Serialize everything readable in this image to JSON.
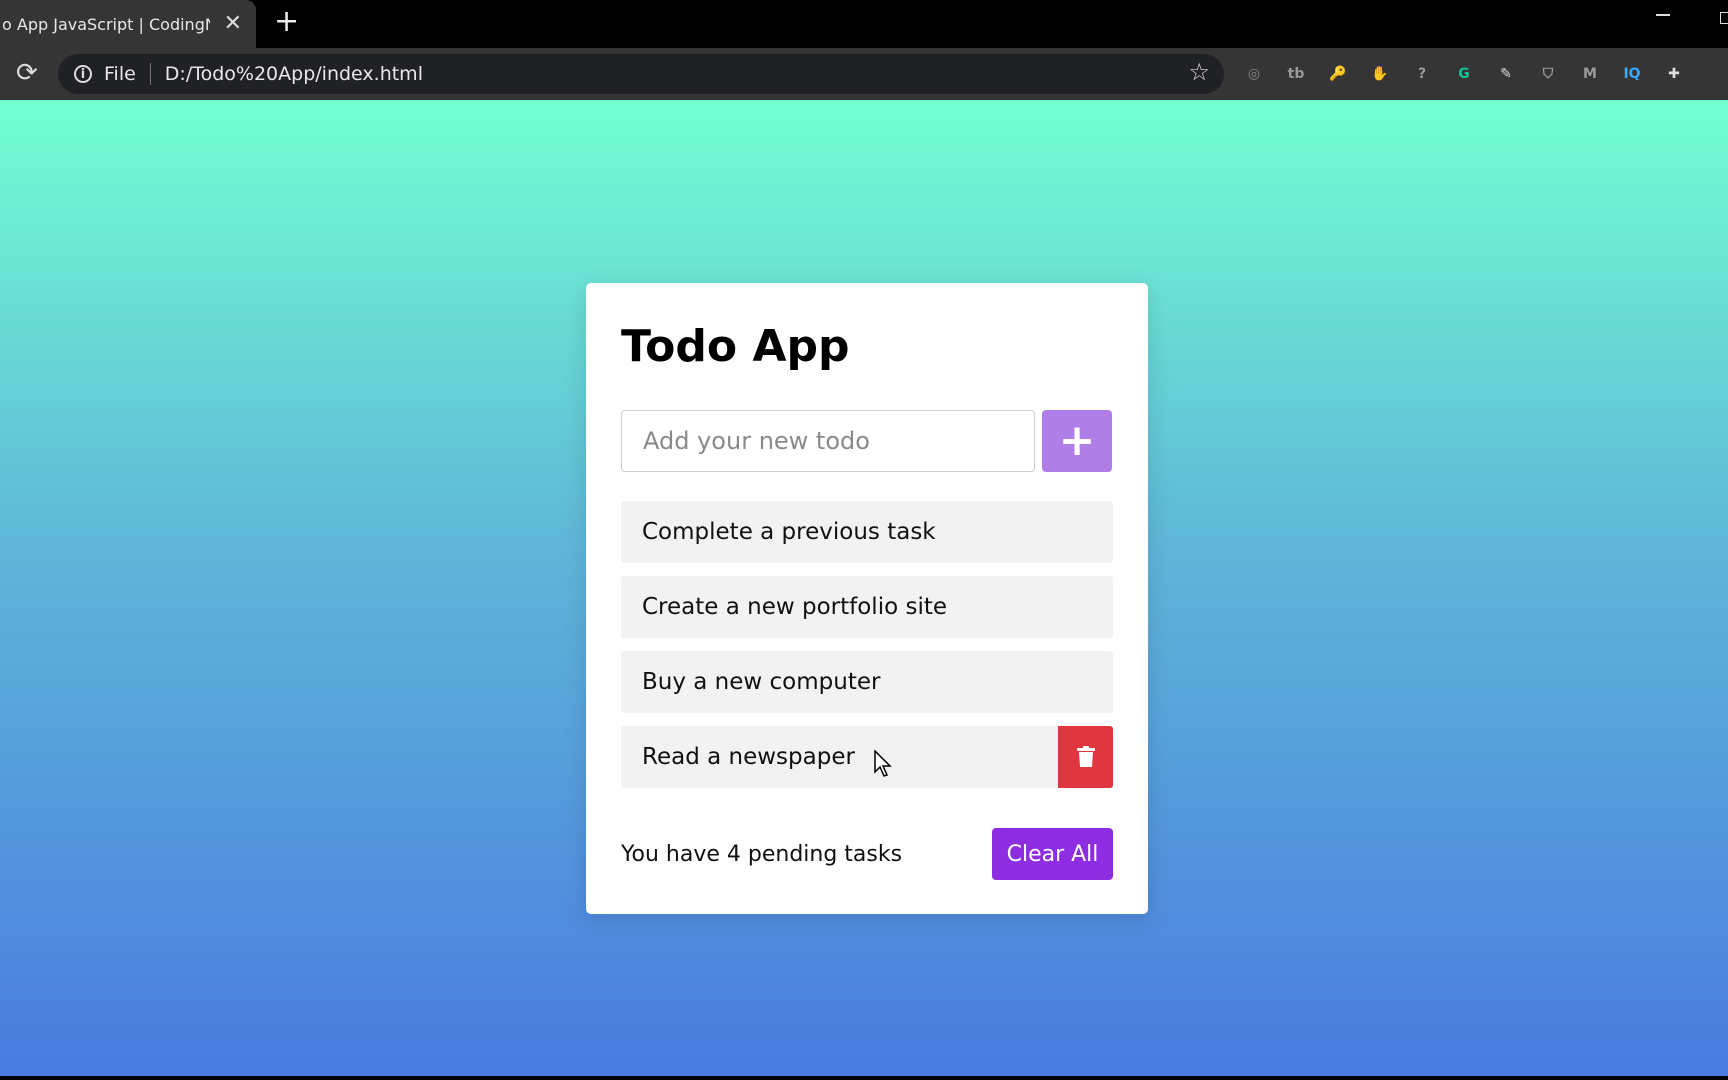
{
  "browser": {
    "tab_title": "o App JavaScript | CodingNep",
    "tab_close": "✕",
    "new_tab": "+",
    "url_scheme_label": "File",
    "url": "D:/Todo%20App/index.html",
    "extensions": [
      {
        "icon": "eye-slash-icon",
        "glyph": "◎",
        "color": "#888888"
      },
      {
        "icon": "tab-icon",
        "glyph": "tb",
        "color": "#9a9a9a"
      },
      {
        "icon": "key-icon",
        "glyph": "🔑",
        "color": "#ff8a00"
      },
      {
        "icon": "hand-stop-icon",
        "glyph": "✋",
        "color": "#e52222"
      },
      {
        "icon": "shield-question-icon",
        "glyph": "?",
        "color": "#9a9a9a"
      },
      {
        "icon": "grammarly-icon",
        "glyph": "G",
        "color": "#15c39a"
      },
      {
        "icon": "pen-icon",
        "glyph": "✎",
        "color": "#dddddd"
      },
      {
        "icon": "shield-icon",
        "glyph": "⛉",
        "color": "#9a9a9a"
      },
      {
        "icon": "m-icon",
        "glyph": "M",
        "color": "#9a9a9a"
      },
      {
        "icon": "iq-icon",
        "glyph": "IQ",
        "color": "#3aa7ff"
      },
      {
        "icon": "puzzle-icon",
        "glyph": "✚",
        "color": "#dddddd"
      }
    ]
  },
  "app": {
    "title": "Todo App",
    "input_placeholder": "Add your new todo",
    "add_label": "+",
    "todos": [
      "Complete a previous task",
      "Create a new portfolio site",
      "Buy a new computer",
      "Read a newspaper"
    ],
    "pending_text": "You have 4 pending tasks",
    "clear_label": "Clear All",
    "colors": {
      "add_button": "#b07ee7",
      "clear_button": "#8e2de2",
      "delete_button": "#e0363f"
    }
  }
}
